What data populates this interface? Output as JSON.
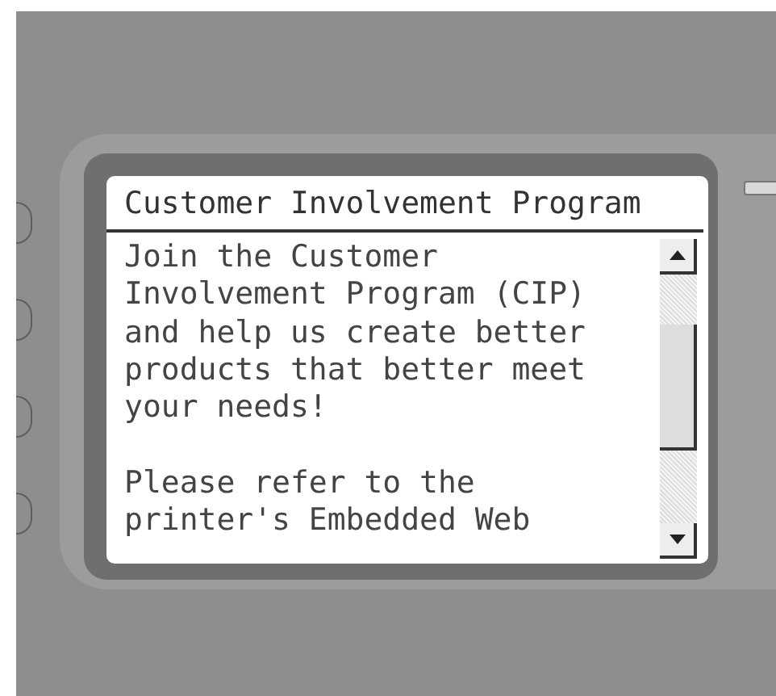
{
  "screen": {
    "title": "Customer Involvement Program",
    "paragraphs": [
      {
        "lines": [
          "Join the Customer",
          "Involvement Program (CIP)",
          "and help us create better",
          "products that better meet",
          "your needs!"
        ]
      },
      {
        "lines": [
          "Please refer to the",
          "printer's Embedded Web"
        ]
      }
    ]
  }
}
